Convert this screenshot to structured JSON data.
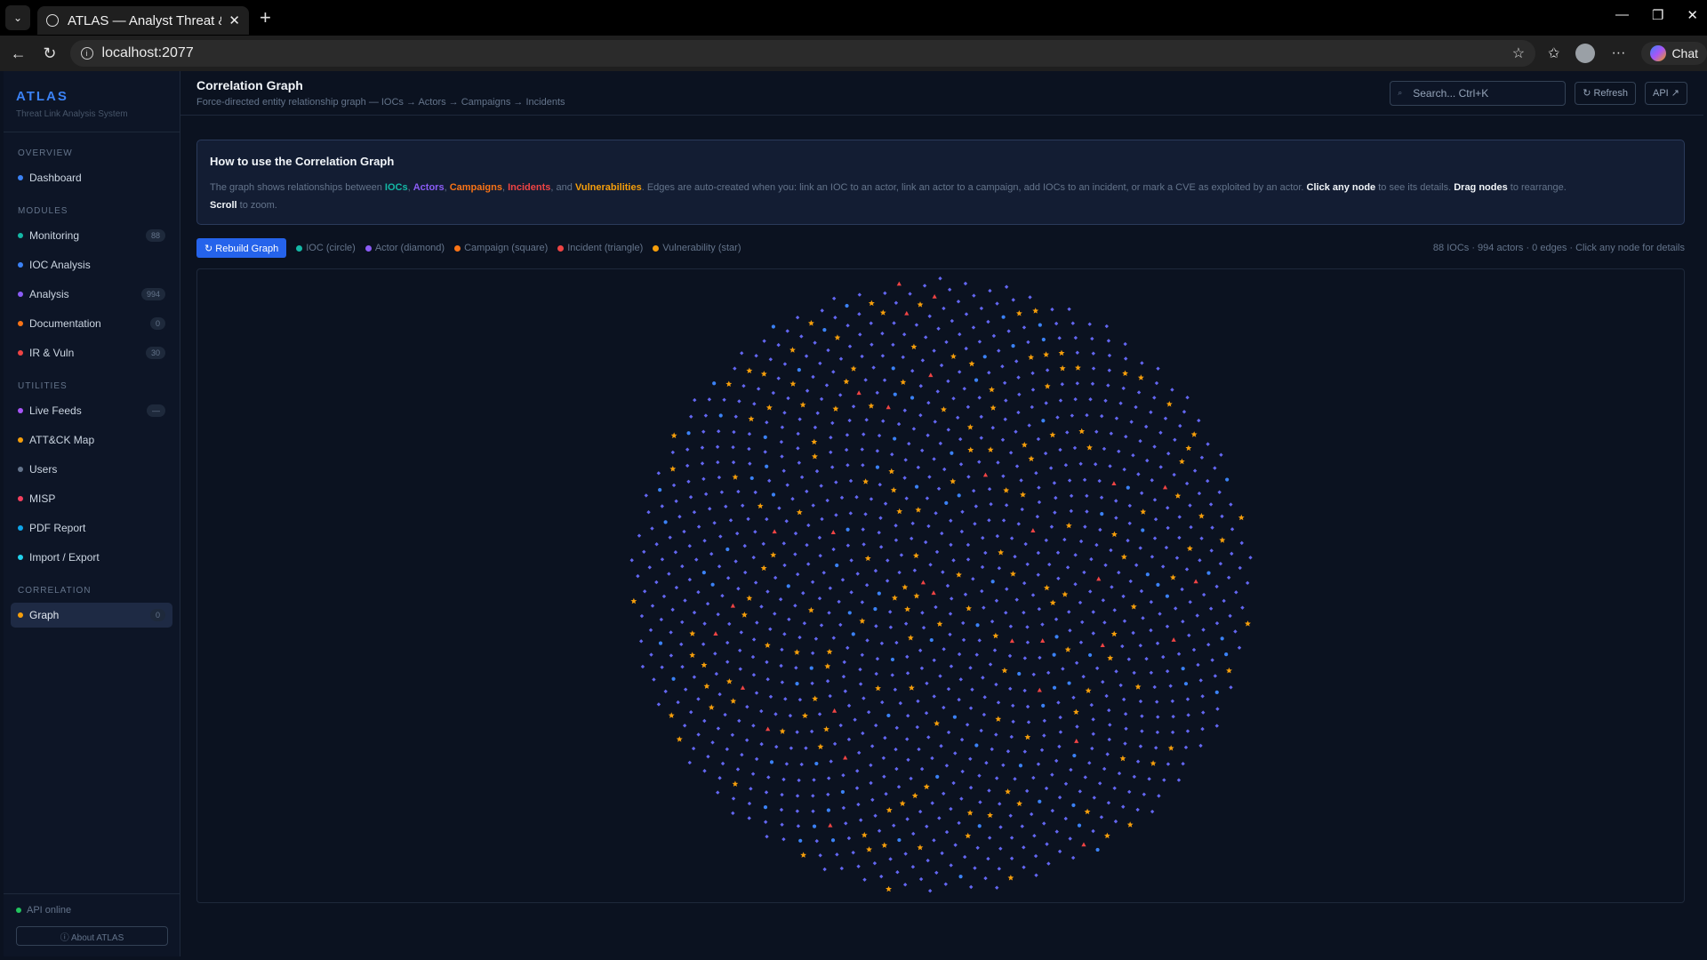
{
  "browser": {
    "tab_title": "ATLAS — Analyst Threat & I",
    "url": "localhost:2077",
    "chat_label": "Chat"
  },
  "sidebar": {
    "brand": "ATLAS",
    "brand_sub": "Threat Link Analysis System",
    "sections": {
      "overview": "OVERVIEW",
      "modules": "MODULES",
      "utilities": "UTILITIES",
      "correlation": "CORRELATION"
    },
    "items": [
      {
        "label": "Dashboard",
        "color": "#3b82f6",
        "badge": ""
      },
      {
        "label": "Monitoring",
        "color": "#14b8a6",
        "badge": "88"
      },
      {
        "label": "IOC Analysis",
        "color": "#3b82f6",
        "badge": ""
      },
      {
        "label": "Analysis",
        "color": "#8b5cf6",
        "badge": "994"
      },
      {
        "label": "Documentation",
        "color": "#f97316",
        "badge": "0"
      },
      {
        "label": "IR & Vuln",
        "color": "#ef4444",
        "badge": "30"
      },
      {
        "label": "Live Feeds",
        "color": "#a855f7",
        "badge": "—"
      },
      {
        "label": "ATT&CK Map",
        "color": "#f59e0b",
        "badge": ""
      },
      {
        "label": "Users",
        "color": "#64748b",
        "badge": ""
      },
      {
        "label": "MISP",
        "color": "#f43f5e",
        "badge": ""
      },
      {
        "label": "PDF Report",
        "color": "#0ea5e9",
        "badge": ""
      },
      {
        "label": "Import / Export",
        "color": "#22d3ee",
        "badge": ""
      },
      {
        "label": "Graph",
        "color": "#f59e0b",
        "badge": "0"
      }
    ],
    "api_status": "API online",
    "about": "ⓘ About ATLAS"
  },
  "header": {
    "title": "Correlation Graph",
    "subtitle": "Force-directed entity relationship graph — IOCs → Actors → Campaigns → Incidents",
    "search_placeholder": "Search... Ctrl+K",
    "refresh": "↻ Refresh",
    "api": "API ↗"
  },
  "howto": {
    "title": "How to use the Correlation Graph",
    "t1": "The graph shows relationships between ",
    "iocs": "IOCs",
    "sep1": ", ",
    "actors": "Actors",
    "sep2": ", ",
    "campaigns": "Campaigns",
    "sep3": ", ",
    "incidents": "Incidents",
    "sep4": ", and ",
    "vulns": "Vulnerabilities",
    "t2": ". Edges are auto-created when you: link an IOC to an actor, link an actor to a campaign, add IOCs to an incident, or mark a CVE as exploited by an actor. ",
    "click": "Click any node",
    "t3": " to see its details. ",
    "drag": "Drag nodes",
    "t4": " to rearrange.",
    "scroll": "Scroll",
    "t5": " to zoom."
  },
  "toolbar": {
    "rebuild": "↻ Rebuild Graph",
    "legend": [
      {
        "label": "IOC (circle)",
        "color": "#14b8a6"
      },
      {
        "label": "Actor (diamond)",
        "color": "#8b5cf6"
      },
      {
        "label": "Campaign (square)",
        "color": "#f97316"
      },
      {
        "label": "Incident (triangle)",
        "color": "#ef4444"
      },
      {
        "label": "Vulnerability (star)",
        "color": "#f59e0b"
      }
    ],
    "stats": "88 IOCs · 994 actors · 0 edges · Click any node for details"
  },
  "graph": {
    "node_counts": {
      "ioc": 88,
      "actor": 994,
      "vulnerability": 150,
      "incident": 30
    },
    "colors": {
      "ioc": "#3b82f6",
      "actor": "#6366f1",
      "vulnerability": "#f59e0b",
      "incident": "#ef4444"
    }
  }
}
